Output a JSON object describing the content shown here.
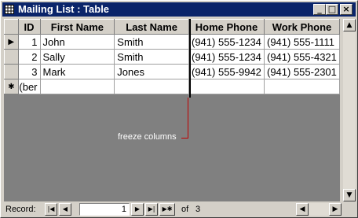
{
  "window": {
    "title": "Mailing List : Table"
  },
  "table": {
    "columns": [
      "ID",
      "First Name",
      "Last Name",
      "Home Phone",
      "Work Phone"
    ],
    "rows": [
      [
        "1",
        "John",
        "Smith",
        "(941) 555-1234",
        "(941) 555-1111"
      ],
      [
        "2",
        "Sally",
        "Smith",
        "(941) 555-1234",
        "(941) 555-4321"
      ],
      [
        "3",
        "Mark",
        "Jones",
        "(941) 555-9942",
        "(941) 555-2301"
      ]
    ],
    "new_row_id": "ber)"
  },
  "callout": {
    "text": "freeze columns",
    "color": "#c00000"
  },
  "navigation": {
    "label": "Record:",
    "current": "1",
    "of_label": "of",
    "total": "3"
  },
  "colors": {
    "titlebar": "#0a246a",
    "workspace": "#808080"
  },
  "icons": [
    "table-icon",
    "minimize-icon",
    "maximize-icon",
    "close-icon",
    "current-record-icon",
    "new-record-icon",
    "first-record-icon",
    "previous-record-icon",
    "next-record-icon",
    "last-record-icon",
    "new-record-nav-icon",
    "scroll-up-icon",
    "scroll-down-icon",
    "scroll-left-icon",
    "scroll-right-icon"
  ]
}
